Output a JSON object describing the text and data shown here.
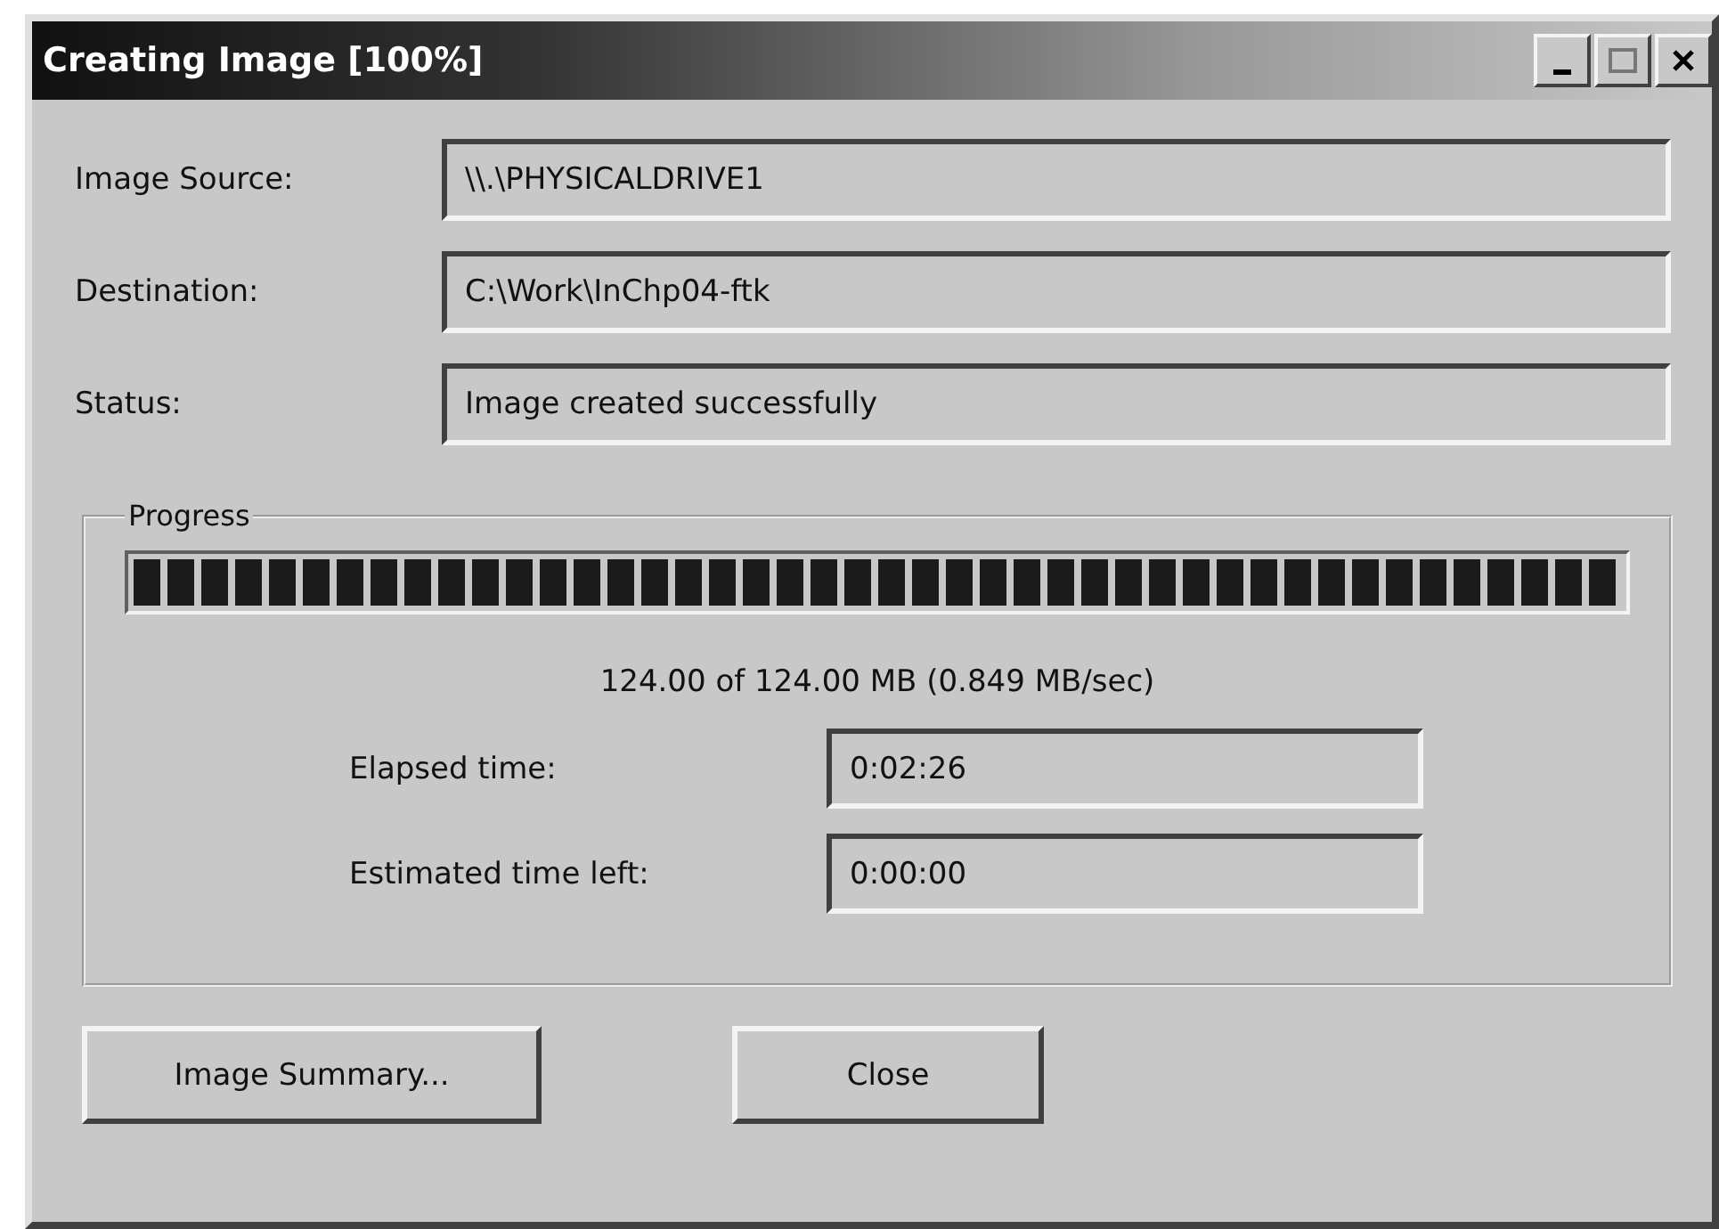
{
  "window": {
    "title": "Creating Image [100%]"
  },
  "fields": [
    {
      "label": "Image Source:",
      "value": "\\\\.\\PHYSICALDRIVE1"
    },
    {
      "label": "Destination:",
      "value": "C:\\Work\\InChp04-ftk"
    },
    {
      "label": "Status:",
      "value": "Image created successfully"
    }
  ],
  "progress": {
    "title": "Progress",
    "level": 1,
    "reading": "124.00 of 124.00 MB (0.849 MB/sec)",
    "times": [
      {
        "label": "Elapsed time:",
        "value": "0:02:26"
      },
      {
        "label": "Estimated time left:",
        "value": "0:00:00"
      }
    ]
  },
  "buttons": [
    "Image Summary...",
    "Close"
  ]
}
